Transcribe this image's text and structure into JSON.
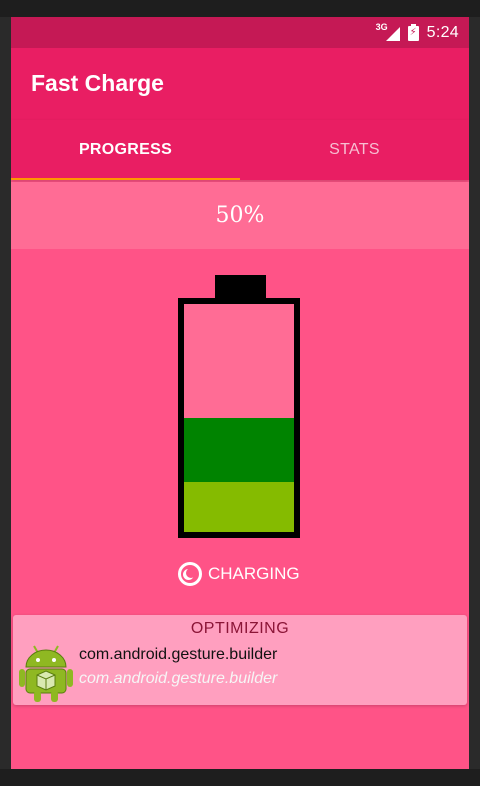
{
  "statusbar": {
    "network": "3G",
    "time": "5:24"
  },
  "app": {
    "title": "Fast Charge"
  },
  "tabs": [
    {
      "label": "PROGRESS",
      "selected": true
    },
    {
      "label": "STATS",
      "selected": false
    }
  ],
  "battery": {
    "percent_label": "50%",
    "level": 0.5,
    "status_label": "CHARGING"
  },
  "optimizing": {
    "title": "OPTIMIZING",
    "package_name": "com.android.gesture.builder",
    "package_subtitle": "com.android.gesture.builder",
    "icon": "android-robot-icon"
  },
  "colors": {
    "status_bar": "#c51955",
    "app_bar": "#e91e63",
    "background": "#ff5387",
    "tab_indicator": "#ff9800",
    "battery_fill_dark": "#008300",
    "battery_fill_light": "#85bb00",
    "card": "#ff9fbf"
  }
}
